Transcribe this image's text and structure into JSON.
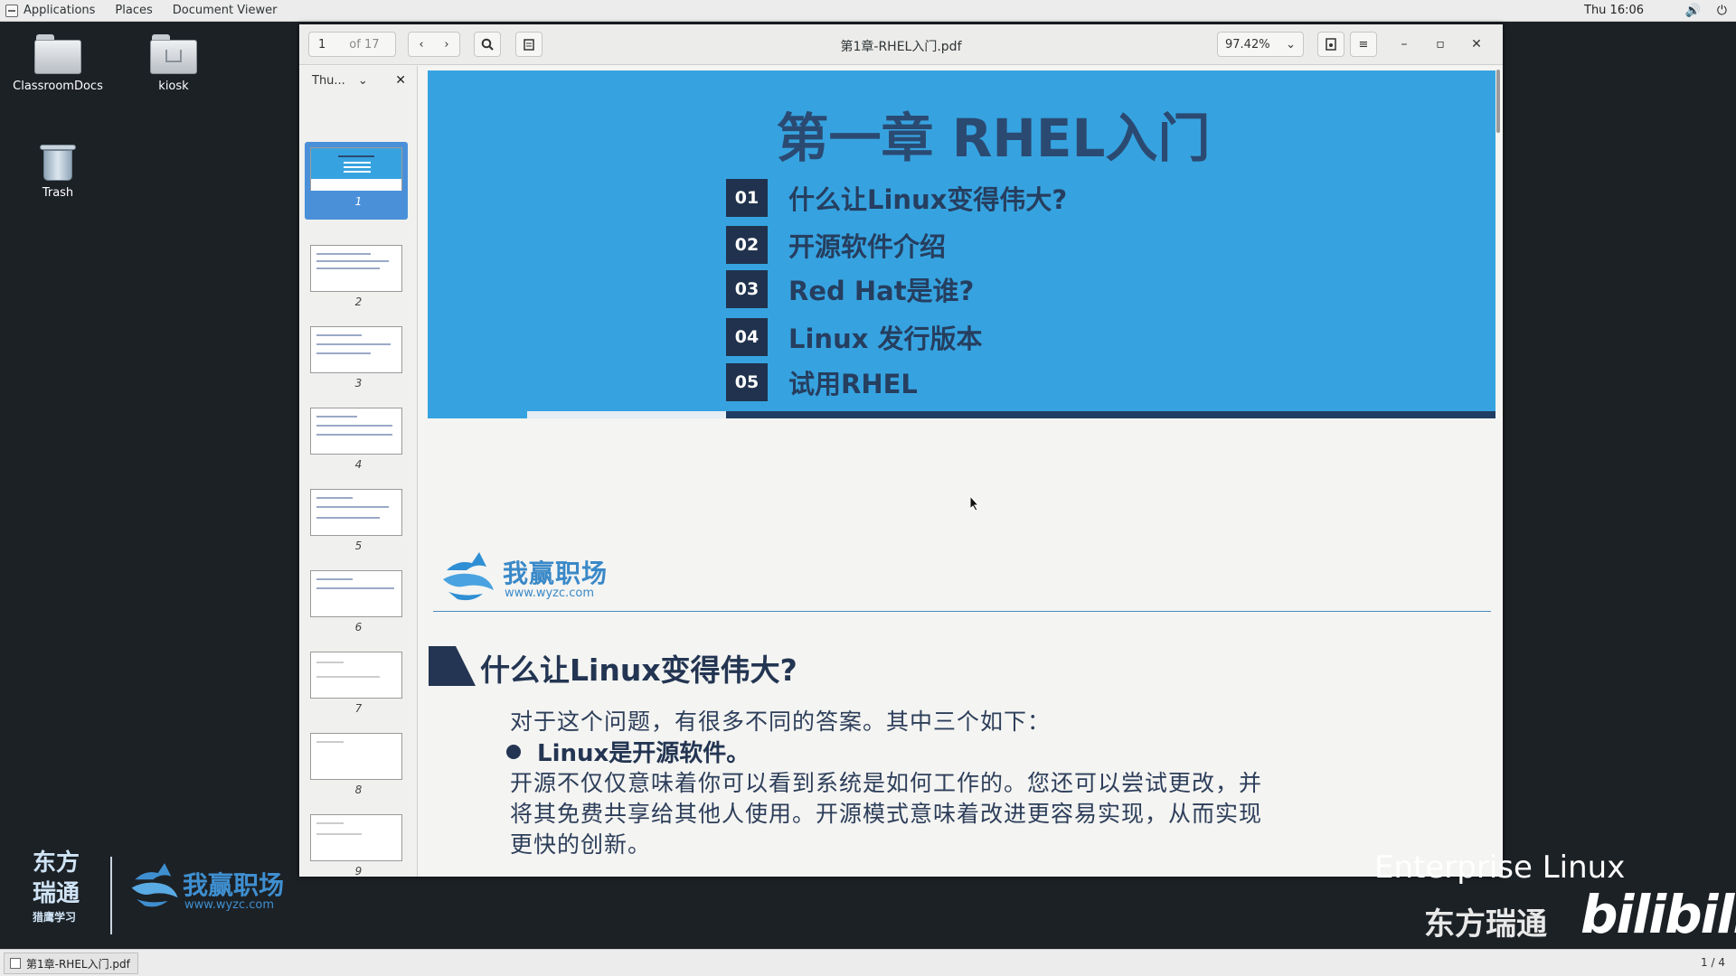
{
  "top_panel": {
    "menus": [
      "Applications",
      "Places",
      "Document Viewer"
    ],
    "clock": "Thu 16:06"
  },
  "desktop": {
    "icons": [
      {
        "label": "ClassroomDocs"
      },
      {
        "label": "kiosk"
      },
      {
        "label": "Trash"
      }
    ]
  },
  "viewer": {
    "page_current": "1",
    "page_total": "of 17",
    "title": "第1章-RHEL入门.pdf",
    "zoom": "97.42%",
    "sidebar": {
      "mode_label": "Thu...",
      "thumbnails": [
        "1",
        "2",
        "3",
        "4",
        "5",
        "6",
        "7",
        "8",
        "9"
      ],
      "selected": "1"
    }
  },
  "document": {
    "banner_title": "第一章 RHEL入门",
    "toc": [
      {
        "num": "01",
        "label": "什么让Linux变得伟大?"
      },
      {
        "num": "02",
        "label": "开源软件介绍"
      },
      {
        "num": "03",
        "label": "Red Hat是谁?"
      },
      {
        "num": "04",
        "label": "Linux 发行版本"
      },
      {
        "num": "05",
        "label": "试用RHEL"
      }
    ],
    "logo_text": "我赢职场",
    "logo_url": "www.wyzc.com",
    "section_title": "什么让Linux变得伟大?",
    "intro": "对于这个问题，有很多不同的答案。其中三个如下：",
    "bullet": "Linux是开源软件。",
    "body_lines": [
      "开源不仅仅意味着你可以看到系统是如何工作的。您还可以尝试更改，并",
      "将其免费共享给其他人使用。开源模式意味着改进更容易实现，从而实现",
      "更快的创新。"
    ]
  },
  "overlay": {
    "brand_cn_1": "东方",
    "brand_cn_2": "瑞通",
    "brand_cn_3": "猎鹰学习",
    "brand_logo_text": "我赢职场",
    "brand_logo_url": "www.wyzc.com",
    "enterprise": "Enterprise Linux",
    "dfrt": "东方瑞通",
    "bilibili": "bilibili"
  },
  "taskbar": {
    "item": "第1章-RHEL入门.pdf",
    "workspace": "1 / 4"
  },
  "colors": {
    "banner": "#36a3e0",
    "toc_box": "#20324d",
    "title_text": "#2b4a72",
    "selection": "#4a90d9"
  }
}
